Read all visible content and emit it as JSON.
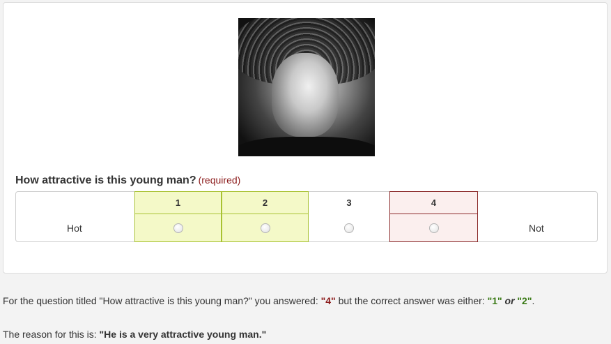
{
  "question": {
    "text": "How attractive is this young man?",
    "required_label": "(required)"
  },
  "scale": {
    "left_label": "Hot",
    "right_label": "Not",
    "options": [
      "1",
      "2",
      "3",
      "4"
    ],
    "selected": "4",
    "correct": [
      "1",
      "2"
    ]
  },
  "feedback": {
    "line1_prefix": "For the question titled \"How attractive is this young man?\" you answered: ",
    "answered": "\"4\"",
    "line1_middle": " but the correct answer was either: ",
    "correct_1": "\"1\"",
    "or_word": " or ",
    "correct_2": "\"2\"",
    "line1_end": ".",
    "line2_prefix": "The reason for this is: ",
    "reason": "\"He is a very attractive young man.\""
  },
  "colors": {
    "correct_fill": "#f4f9c8",
    "correct_border": "#a8c232",
    "wrong_fill": "#fbefee",
    "wrong_border": "#8b2a2a",
    "required_text": "#8b1a1a",
    "correct_text": "#3a7a16"
  }
}
